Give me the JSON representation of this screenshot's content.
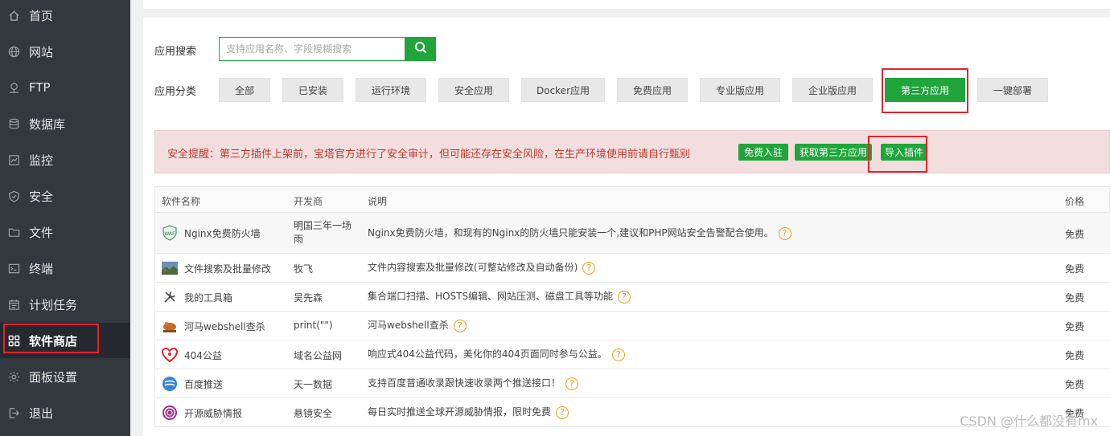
{
  "sidebar": {
    "items": [
      {
        "label": "首页",
        "icon": "home-icon"
      },
      {
        "label": "网站",
        "icon": "globe-icon"
      },
      {
        "label": "FTP",
        "icon": "ftp-icon"
      },
      {
        "label": "数据库",
        "icon": "database-icon"
      },
      {
        "label": "监控",
        "icon": "monitor-icon"
      },
      {
        "label": "安全",
        "icon": "shield-icon"
      },
      {
        "label": "文件",
        "icon": "folder-icon"
      },
      {
        "label": "终端",
        "icon": "terminal-icon"
      },
      {
        "label": "计划任务",
        "icon": "calendar-icon"
      },
      {
        "label": "软件商店",
        "icon": "grid-icon",
        "active": true
      },
      {
        "label": "面板设置",
        "icon": "gear-icon"
      },
      {
        "label": "退出",
        "icon": "logout-icon"
      }
    ]
  },
  "search": {
    "label": "应用搜索",
    "placeholder": "支持应用名称、字段模糊搜索"
  },
  "categories": {
    "label": "应用分类",
    "items": [
      "全部",
      "已安装",
      "运行环境",
      "安全应用",
      "Docker应用",
      "免费应用",
      "专业版应用",
      "企业版应用",
      "第三方应用",
      "一键部署"
    ],
    "selected": "第三方应用"
  },
  "alert": {
    "text": "安全提醒：第三方插件上架前，宝塔官方进行了安全审计，但可能还存在安全风险，在生产环境使用前请自行甄别",
    "buttons": [
      "免费入驻",
      "获取第三方应用",
      "导入插件"
    ]
  },
  "table": {
    "headers": {
      "name": "软件名称",
      "developer": "开发商",
      "desc": "说明",
      "price": "价格"
    },
    "rows": [
      {
        "name": "Nginx免费防火墙",
        "developer": "明国三年一场雨",
        "desc": "Nginx免费防火墙，和现有的Nginx的防火墙只能安装一个,建议和PHP网站安全告警配合使用。",
        "price": "免费",
        "icon": "waf-icon"
      },
      {
        "name": "文件搜索及批量修改",
        "developer": "牧飞",
        "desc": "文件内容搜索及批量修改(可整站修改及自动备份)",
        "price": "免费",
        "icon": "landscape-icon"
      },
      {
        "name": "我的工具箱",
        "developer": "吴先森",
        "desc": "集合端口扫描、HOSTS编辑、网站压测、磁盘工具等功能",
        "price": "免费",
        "icon": "tools-icon"
      },
      {
        "name": "河马webshell查杀",
        "developer": "print(\"\")",
        "desc": "河马webshell查杀",
        "price": "免费",
        "icon": "hippo-icon"
      },
      {
        "name": "404公益",
        "developer": "域名公益网",
        "desc": "响应式404公益代码，美化你的404页面同时参与公益。",
        "price": "免费",
        "icon": "heart-icon"
      },
      {
        "name": "百度推送",
        "developer": "天一数据",
        "desc": "支持百度普通收录跟快速收录两个推送接口！",
        "price": "免费",
        "icon": "baidu-push-icon"
      },
      {
        "name": "开源威胁情报",
        "developer": "悬镜安全",
        "desc": "每日实时推送全球开源威胁情报，限时免费",
        "price": "免费",
        "icon": "radar-icon"
      }
    ]
  },
  "help_glyph": "?",
  "watermark": "CSDN @什么都没有mx",
  "colors": {
    "accent": "#20a53a",
    "sidebar_bg": "#33373e",
    "alert_bg": "#f2dede",
    "alert_text": "#c0392b",
    "annotation_red": "#e3242b",
    "help_orange": "#f39b16"
  }
}
